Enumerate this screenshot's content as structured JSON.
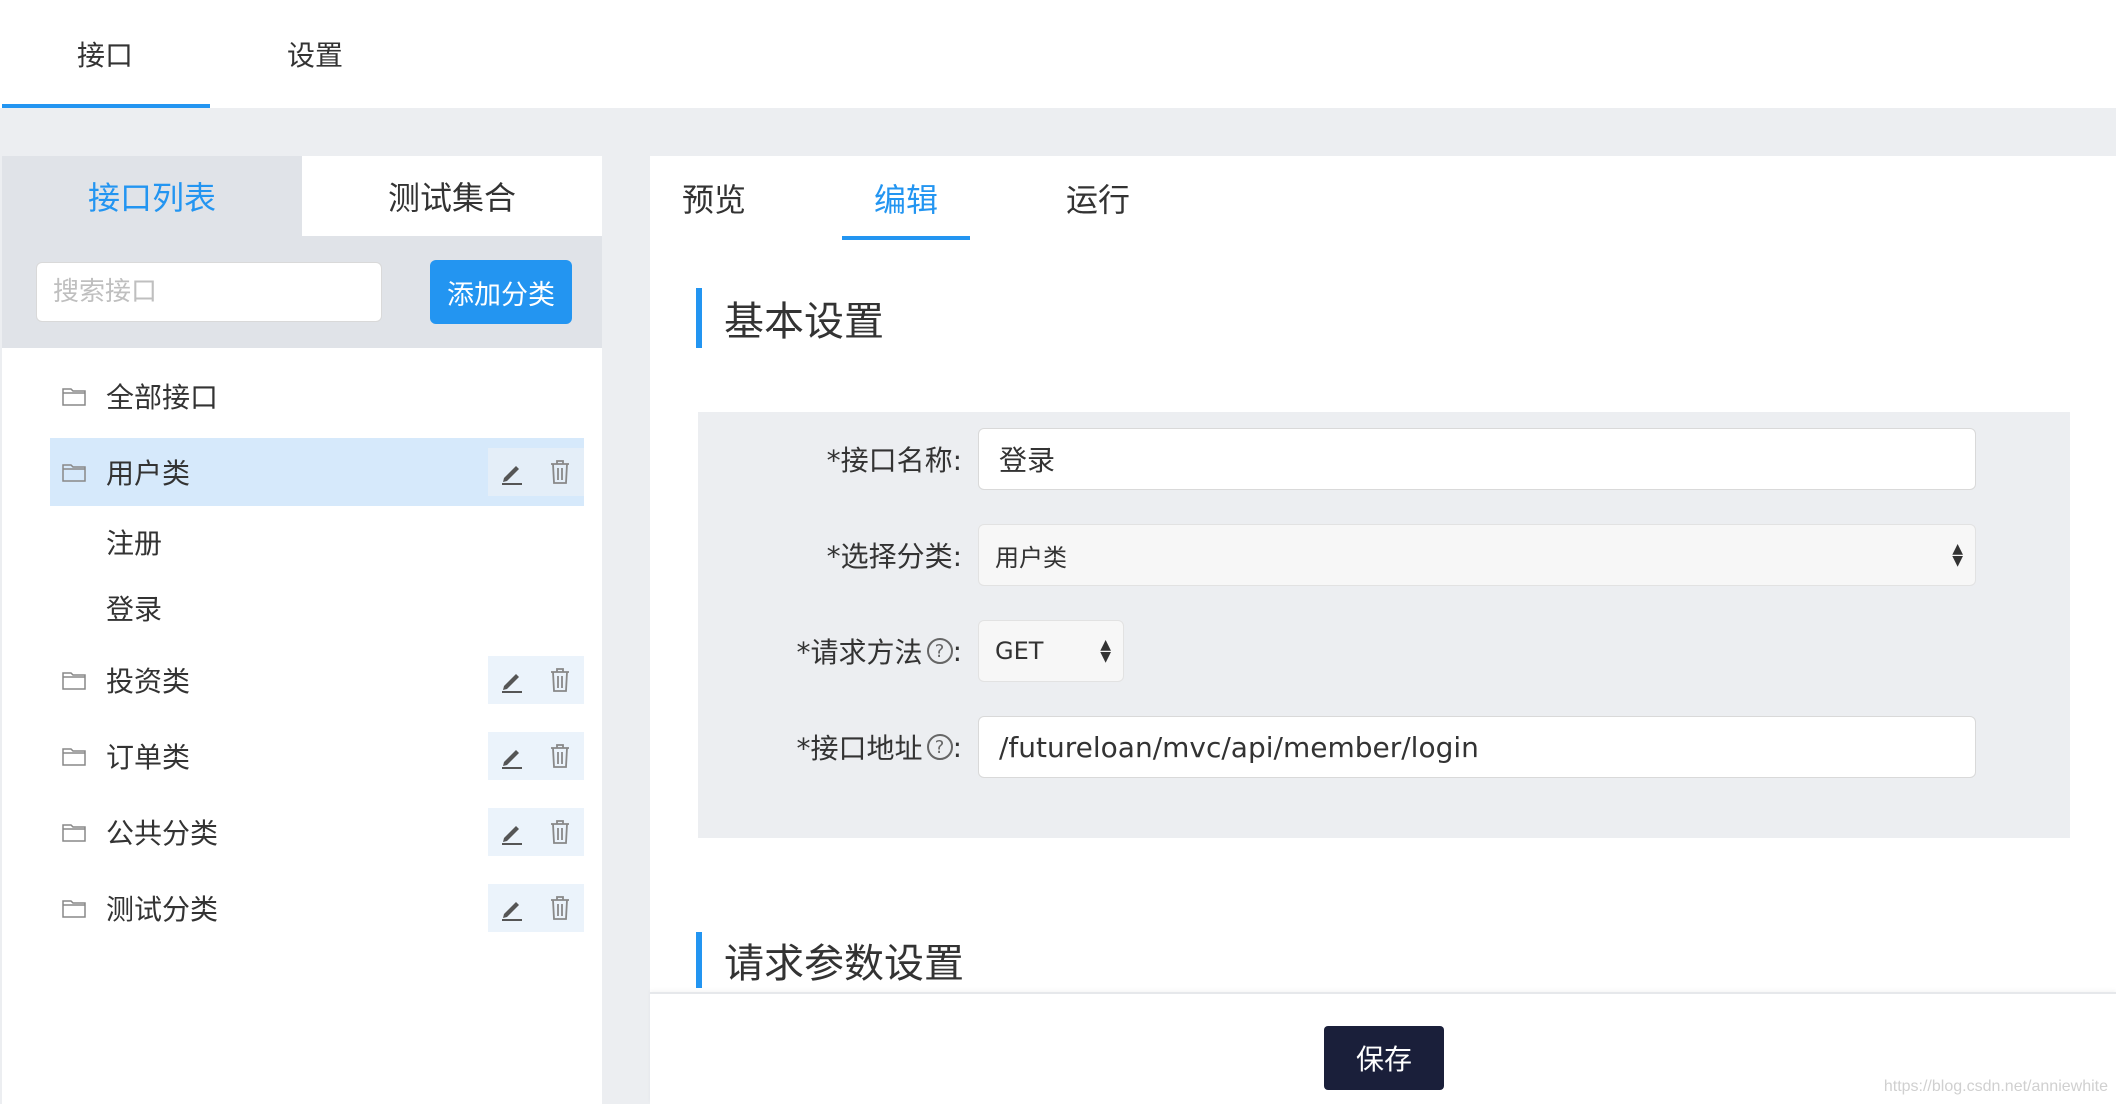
{
  "topnav": {
    "tabs": [
      {
        "label": "接口"
      },
      {
        "label": "设置"
      }
    ]
  },
  "left": {
    "tabs": [
      {
        "label": "接口列表"
      },
      {
        "label": "测试集合"
      }
    ],
    "search_placeholder": "搜索接口",
    "add_category_label": "添加分类",
    "tree": {
      "all": "全部接口",
      "categories": [
        {
          "label": "用户类",
          "children": [
            "注册",
            "登录"
          ]
        },
        {
          "label": "投资类"
        },
        {
          "label": "订单类"
        },
        {
          "label": "公共分类"
        },
        {
          "label": "测试分类"
        }
      ]
    }
  },
  "right": {
    "tabs": [
      {
        "label": "预览"
      },
      {
        "label": "编辑"
      },
      {
        "label": "运行"
      }
    ],
    "section_basic": "基本设置",
    "section_params": "请求参数设置",
    "form": {
      "name_label": "*接口名称:",
      "name_value": "登录",
      "category_label": "*选择分类:",
      "category_value": "用户类",
      "method_label": "*请求方法",
      "method_value": "GET",
      "path_label": "*接口地址",
      "path_value": "/futureloan/mvc/api/member/login",
      "colon": ":",
      "help_glyph": "?"
    },
    "save_label": "保存"
  },
  "watermark": "https://blog.csdn.net/anniewhite",
  "colors": {
    "accent": "#2395f1",
    "selected_row": "#d6e9fb",
    "save_button": "#1a1f3a"
  }
}
